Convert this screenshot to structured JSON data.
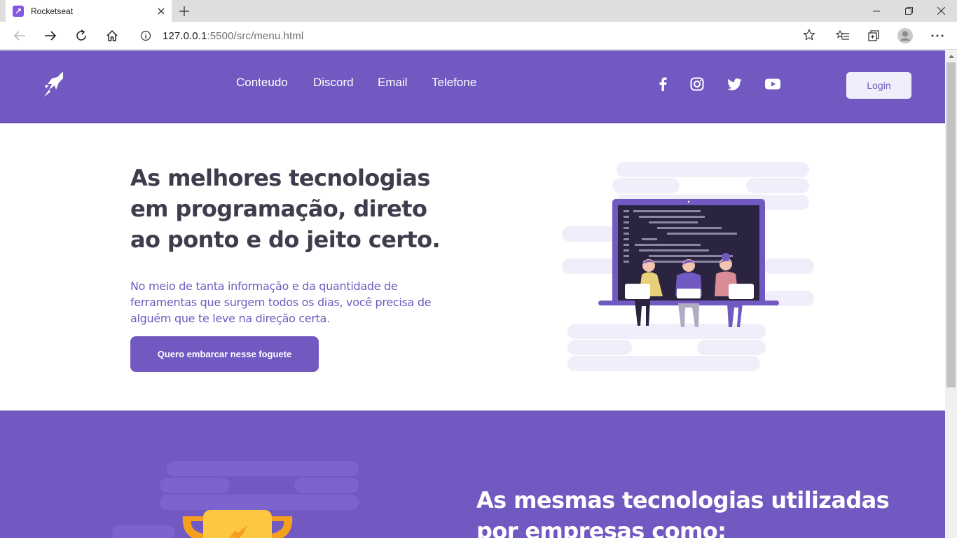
{
  "browser": {
    "tab_title": "Rocketseat",
    "url_host": "127.0.0.1",
    "url_rest": ":5500/src/menu.html"
  },
  "header": {
    "logo": "rocket-logo-icon",
    "nav": [
      "Conteudo",
      "Discord",
      "Email",
      "Telefone"
    ],
    "social": [
      "facebook-icon",
      "instagram-icon",
      "twitter-icon",
      "youtube-icon"
    ],
    "login_label": "Login"
  },
  "hero": {
    "title": "As melhores tecnologias em programação, direto ao ponto e do jeito certo.",
    "text": "No meio de tanta informação e da quantidade de ferramentas que surgem todos os dias, você precisa de alguém que te leve na direção certa.",
    "cta_label": "Quero embarcar nesse foguete"
  },
  "section2": {
    "title": "As mesmas tecnologias utilizadas por empresas como:"
  },
  "colors": {
    "brand": "#7159c1",
    "text_dark": "#3d3d4d",
    "cloud": "#f0eefa"
  }
}
